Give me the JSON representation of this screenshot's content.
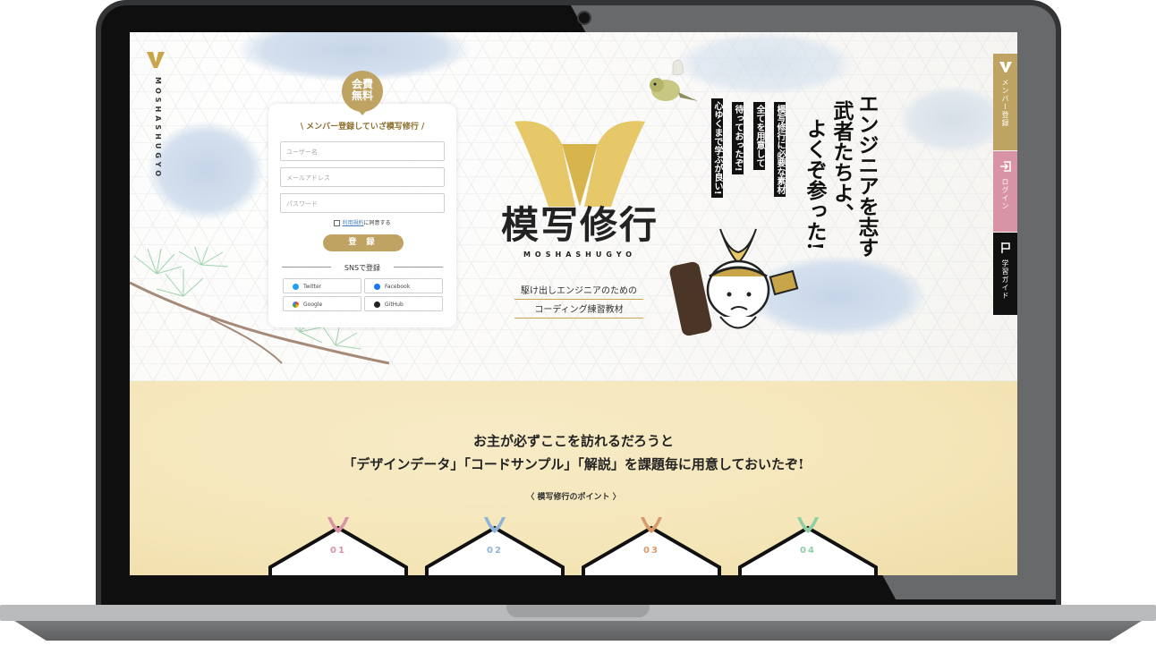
{
  "brand": {
    "side_logo_text": "MOSHASHUGYO",
    "logo_text": "模写修行",
    "logo_sub": "MOSHASHUGYO"
  },
  "signup": {
    "badge_line1": "会費",
    "badge_line2": "無料",
    "title": "\\ メンバー登録していざ模写修行 /",
    "username_placeholder": "ユーザー名",
    "email_placeholder": "メールアドレス",
    "password_placeholder": "パスワード",
    "terms_link": "利用規約",
    "terms_suffix": "に同意する",
    "submit_label": "登 録",
    "sns_label": "SNSで登録",
    "sns": [
      {
        "label": "Twitter",
        "color": "#1da1f2"
      },
      {
        "label": "Facebook",
        "color": "#1877f2"
      },
      {
        "label": "Google",
        "color": "#ea4335"
      },
      {
        "label": "GitHub",
        "color": "#222222"
      }
    ]
  },
  "hero": {
    "tagline1": "駆け出しエンジニアのための",
    "tagline2": "コーディング練習教材",
    "catch_col1": "エンジニアを志す",
    "catch_col2": "武者たちよ、",
    "catch_col3": "よくぞ参った!",
    "boxed_col1": "模写修行に必要な素材",
    "boxed_col2": "全てを用意して",
    "boxed_col3": "待っておったぞ!",
    "boxed_col4": "心ゆくまで学ぶが良い!"
  },
  "side_tabs": {
    "member": "メンバー登録",
    "login": "ログイン",
    "guide": "学習ガイド"
  },
  "lower": {
    "line1": "お主が必ずここを訪れるだろうと",
    "line2": "「デザインデータ」「コードサンプル」「解説」を課題毎に用意しておいたぞ!",
    "points_heading": "〈 模写修行のポイント 〉",
    "cards": [
      {
        "num": "01",
        "color": "#d893a4"
      },
      {
        "num": "02",
        "color": "#8fb4d8"
      },
      {
        "num": "03",
        "color": "#d89a6a"
      },
      {
        "num": "04",
        "color": "#8fcfa6"
      }
    ]
  },
  "colors": {
    "gold": "#bfa362",
    "pink": "#d893a4",
    "black": "#111111",
    "cream": "#f5e6b9"
  }
}
